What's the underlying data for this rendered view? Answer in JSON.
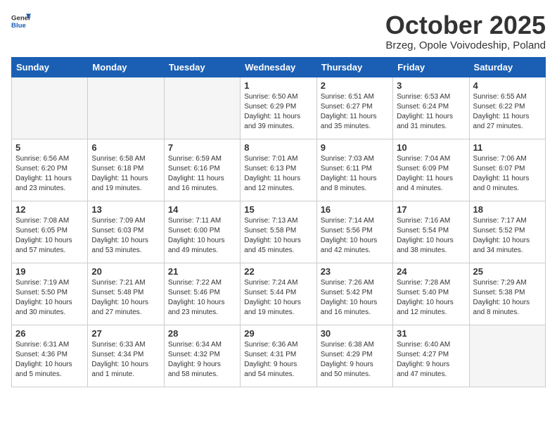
{
  "header": {
    "logo_general": "General",
    "logo_blue": "Blue",
    "month": "October 2025",
    "location": "Brzeg, Opole Voivodeship, Poland"
  },
  "weekdays": [
    "Sunday",
    "Monday",
    "Tuesday",
    "Wednesday",
    "Thursday",
    "Friday",
    "Saturday"
  ],
  "weeks": [
    [
      {
        "day": "",
        "info": ""
      },
      {
        "day": "",
        "info": ""
      },
      {
        "day": "",
        "info": ""
      },
      {
        "day": "1",
        "info": "Sunrise: 6:50 AM\nSunset: 6:29 PM\nDaylight: 11 hours\nand 39 minutes."
      },
      {
        "day": "2",
        "info": "Sunrise: 6:51 AM\nSunset: 6:27 PM\nDaylight: 11 hours\nand 35 minutes."
      },
      {
        "day": "3",
        "info": "Sunrise: 6:53 AM\nSunset: 6:24 PM\nDaylight: 11 hours\nand 31 minutes."
      },
      {
        "day": "4",
        "info": "Sunrise: 6:55 AM\nSunset: 6:22 PM\nDaylight: 11 hours\nand 27 minutes."
      }
    ],
    [
      {
        "day": "5",
        "info": "Sunrise: 6:56 AM\nSunset: 6:20 PM\nDaylight: 11 hours\nand 23 minutes."
      },
      {
        "day": "6",
        "info": "Sunrise: 6:58 AM\nSunset: 6:18 PM\nDaylight: 11 hours\nand 19 minutes."
      },
      {
        "day": "7",
        "info": "Sunrise: 6:59 AM\nSunset: 6:16 PM\nDaylight: 11 hours\nand 16 minutes."
      },
      {
        "day": "8",
        "info": "Sunrise: 7:01 AM\nSunset: 6:13 PM\nDaylight: 11 hours\nand 12 minutes."
      },
      {
        "day": "9",
        "info": "Sunrise: 7:03 AM\nSunset: 6:11 PM\nDaylight: 11 hours\nand 8 minutes."
      },
      {
        "day": "10",
        "info": "Sunrise: 7:04 AM\nSunset: 6:09 PM\nDaylight: 11 hours\nand 4 minutes."
      },
      {
        "day": "11",
        "info": "Sunrise: 7:06 AM\nSunset: 6:07 PM\nDaylight: 11 hours\nand 0 minutes."
      }
    ],
    [
      {
        "day": "12",
        "info": "Sunrise: 7:08 AM\nSunset: 6:05 PM\nDaylight: 10 hours\nand 57 minutes."
      },
      {
        "day": "13",
        "info": "Sunrise: 7:09 AM\nSunset: 6:03 PM\nDaylight: 10 hours\nand 53 minutes."
      },
      {
        "day": "14",
        "info": "Sunrise: 7:11 AM\nSunset: 6:00 PM\nDaylight: 10 hours\nand 49 minutes."
      },
      {
        "day": "15",
        "info": "Sunrise: 7:13 AM\nSunset: 5:58 PM\nDaylight: 10 hours\nand 45 minutes."
      },
      {
        "day": "16",
        "info": "Sunrise: 7:14 AM\nSunset: 5:56 PM\nDaylight: 10 hours\nand 42 minutes."
      },
      {
        "day": "17",
        "info": "Sunrise: 7:16 AM\nSunset: 5:54 PM\nDaylight: 10 hours\nand 38 minutes."
      },
      {
        "day": "18",
        "info": "Sunrise: 7:17 AM\nSunset: 5:52 PM\nDaylight: 10 hours\nand 34 minutes."
      }
    ],
    [
      {
        "day": "19",
        "info": "Sunrise: 7:19 AM\nSunset: 5:50 PM\nDaylight: 10 hours\nand 30 minutes."
      },
      {
        "day": "20",
        "info": "Sunrise: 7:21 AM\nSunset: 5:48 PM\nDaylight: 10 hours\nand 27 minutes."
      },
      {
        "day": "21",
        "info": "Sunrise: 7:22 AM\nSunset: 5:46 PM\nDaylight: 10 hours\nand 23 minutes."
      },
      {
        "day": "22",
        "info": "Sunrise: 7:24 AM\nSunset: 5:44 PM\nDaylight: 10 hours\nand 19 minutes."
      },
      {
        "day": "23",
        "info": "Sunrise: 7:26 AM\nSunset: 5:42 PM\nDaylight: 10 hours\nand 16 minutes."
      },
      {
        "day": "24",
        "info": "Sunrise: 7:28 AM\nSunset: 5:40 PM\nDaylight: 10 hours\nand 12 minutes."
      },
      {
        "day": "25",
        "info": "Sunrise: 7:29 AM\nSunset: 5:38 PM\nDaylight: 10 hours\nand 8 minutes."
      }
    ],
    [
      {
        "day": "26",
        "info": "Sunrise: 6:31 AM\nSunset: 4:36 PM\nDaylight: 10 hours\nand 5 minutes."
      },
      {
        "day": "27",
        "info": "Sunrise: 6:33 AM\nSunset: 4:34 PM\nDaylight: 10 hours\nand 1 minute."
      },
      {
        "day": "28",
        "info": "Sunrise: 6:34 AM\nSunset: 4:32 PM\nDaylight: 9 hours\nand 58 minutes."
      },
      {
        "day": "29",
        "info": "Sunrise: 6:36 AM\nSunset: 4:31 PM\nDaylight: 9 hours\nand 54 minutes."
      },
      {
        "day": "30",
        "info": "Sunrise: 6:38 AM\nSunset: 4:29 PM\nDaylight: 9 hours\nand 50 minutes."
      },
      {
        "day": "31",
        "info": "Sunrise: 6:40 AM\nSunset: 4:27 PM\nDaylight: 9 hours\nand 47 minutes."
      },
      {
        "day": "",
        "info": ""
      }
    ]
  ]
}
